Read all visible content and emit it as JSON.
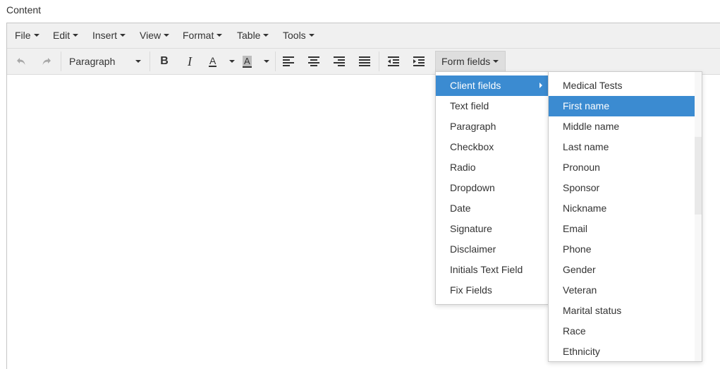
{
  "page": {
    "label": "Content"
  },
  "menubar": {
    "items": [
      {
        "label": "File"
      },
      {
        "label": "Edit"
      },
      {
        "label": "Insert"
      },
      {
        "label": "View"
      },
      {
        "label": "Format"
      },
      {
        "label": "Table"
      },
      {
        "label": "Tools"
      }
    ]
  },
  "toolbar": {
    "block_format": "Paragraph",
    "form_fields_label": "Form fields",
    "icons": [
      "undo-icon",
      "redo-icon",
      "bold-icon",
      "italic-icon",
      "text-color-icon",
      "background-color-icon",
      "align-left-icon",
      "align-center-icon",
      "align-right-icon",
      "align-justify-icon",
      "outdent-icon",
      "indent-icon"
    ]
  },
  "form_fields_menu": {
    "items": [
      {
        "label": "Client fields"
      },
      {
        "label": "Text field"
      },
      {
        "label": "Paragraph"
      },
      {
        "label": "Checkbox"
      },
      {
        "label": "Radio"
      },
      {
        "label": "Dropdown"
      },
      {
        "label": "Date"
      },
      {
        "label": "Signature"
      },
      {
        "label": "Disclaimer"
      },
      {
        "label": "Initials Text Field"
      },
      {
        "label": "Fix Fields"
      }
    ]
  },
  "client_fields_submenu": {
    "items": [
      {
        "label": "Medical Tests"
      },
      {
        "label": "First name"
      },
      {
        "label": "Middle name"
      },
      {
        "label": "Last name"
      },
      {
        "label": "Pronoun"
      },
      {
        "label": "Sponsor"
      },
      {
        "label": "Nickname"
      },
      {
        "label": "Email"
      },
      {
        "label": "Phone"
      },
      {
        "label": "Gender"
      },
      {
        "label": "Veteran"
      },
      {
        "label": "Marital status"
      },
      {
        "label": "Race"
      },
      {
        "label": "Ethnicity"
      }
    ]
  },
  "colors": {
    "accent": "#3b8bd1",
    "toolbar_bg": "#f0f0f0"
  }
}
